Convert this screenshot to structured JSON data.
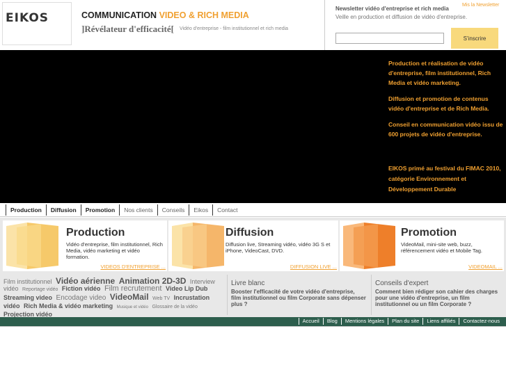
{
  "header": {
    "logo_text": "EIKOS",
    "title_black": "COMMUNICATION",
    "title_orange": "VIDEO & RICH MEDIA",
    "tagline": "]Révélateur d'efficacité[",
    "tagline_sub": "Vidéo d'entreprise - film institutionnel et rich media"
  },
  "newsletter": {
    "title": "Newsletter vidéo d'entreprise et rich media",
    "subtitle": "Veille en production et diffusion de vidéo d'entreprise.",
    "corner_link": "Mis la Newsletter",
    "input_placeholder": "",
    "button_label": "S'inscrire"
  },
  "hero": {
    "paragraphs": [
      "Production et réalisation de vidéo d'entreprise, film institutionnel, Rich Media et vidéo marketing.",
      "Diffusion et promotion de contenus vidéo d'entreprise et de Rich Media.",
      "Conseil en communication vidéo issu de 600 projets de vidéo d'entreprise."
    ],
    "award": "EIKOS primé au festival du FIMAC 2010, catégorie Environnement et Développement Durable"
  },
  "nav": {
    "items": [
      "Production",
      "Diffusion",
      "Promotion",
      "Nos clients",
      "Conseils",
      "Eikos",
      "Contact"
    ]
  },
  "sections": [
    {
      "title": "Production",
      "desc": "Vidéo d'entreprise, film institutionnel, Rich Media, vidéo marketing et vidéo formation.",
      "link": "VIDEOS D'ENTREPRISE ..."
    },
    {
      "title": "Diffusion",
      "desc": "Diffusion live, Streaming vidéo, vidéo 3G S et iPhone, VideoCast, DVD.",
      "link": "DIFFUSION LIVE ..."
    },
    {
      "title": "Promotion",
      "desc": "VideoMail, mini-site web, buzz, référencement vidéo et Mobile Tag.",
      "link": "VIDEOMAIL ..."
    }
  ],
  "tagcloud": [
    "Film institutionnel",
    "Vidéo aérienne",
    "Animation 2D-3D",
    "Interview vidéo",
    "Reportage vidéo",
    "Fiction vidéo",
    "Film recrutement",
    "Video Lip Dub",
    "Streaming video",
    "Encodage video",
    "VideoMail",
    "Web TV",
    "Incrustation vidéo",
    "Rich Media & vidéo marketing",
    "Musique et vidéo",
    "Glossaire de la vidéo",
    "Projection vidéo"
  ],
  "livre_blanc": {
    "title": "Livre blanc",
    "text": "Booster l'efficacité de votre vidéo d'entreprise, film institutionnel ou film Corporate sans dépenser plus ?"
  },
  "conseils_expert": {
    "title": "Conseils d'expert",
    "text": "Comment bien rédiger son cahier des charges pour une vidéo d'entreprise, un film institutionnel ou un film Corporate ?"
  },
  "footer": {
    "items": [
      "Accueil",
      "Blog",
      "Mentions légales",
      "Plan du site",
      "Liens affiliés",
      "Contactez-nous"
    ]
  },
  "colors": {
    "accent": "#f0a030",
    "footer_bg": "#2d5e4d"
  }
}
